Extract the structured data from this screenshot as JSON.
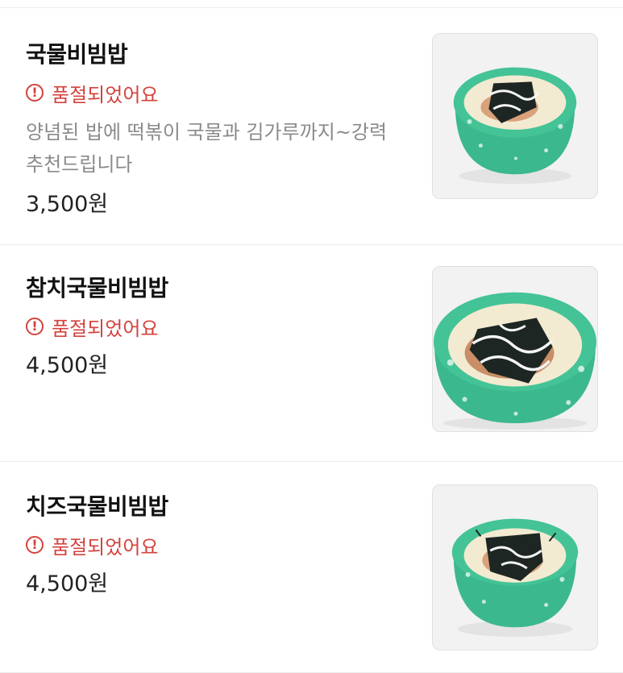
{
  "menu": {
    "items": [
      {
        "name": "국물비빔밥",
        "status": "품절되었어요",
        "description": "양념된 밥에 떡볶이 국물과 김가루까지~강력\n추천드립니다",
        "price": "3,500원"
      },
      {
        "name": "참치국물비빔밥",
        "status": "품절되었어요",
        "description": "",
        "price": "4,500원"
      },
      {
        "name": "치즈국물비빔밥",
        "status": "품절되었어요",
        "description": "",
        "price": "4,500원"
      }
    ]
  },
  "colors": {
    "soldout": "#d4423d",
    "bowl": "#3cb88e",
    "description": "#8a8a8a"
  },
  "icons": {
    "soldout": "exclamation-circle-icon"
  }
}
